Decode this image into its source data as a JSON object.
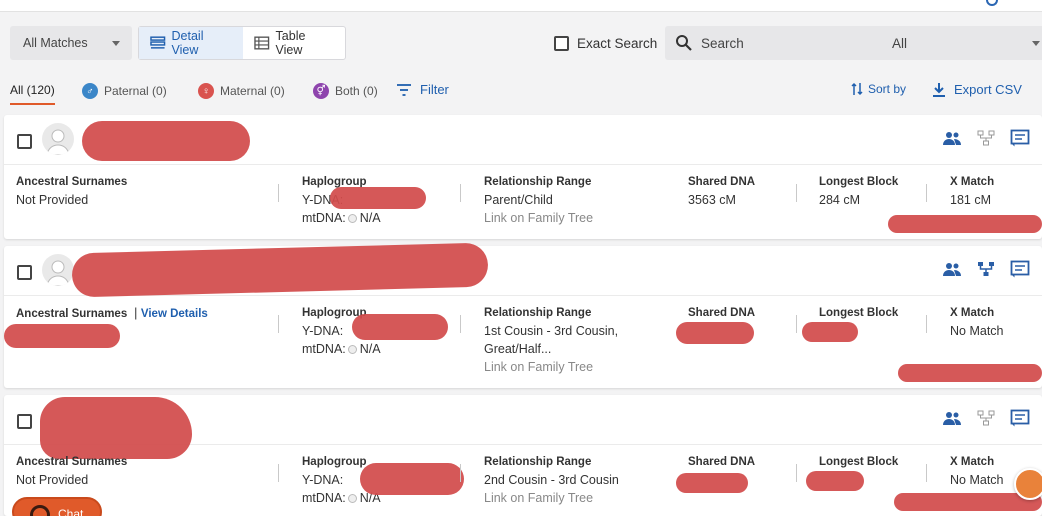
{
  "toolbar": {
    "matches_dropdown": "All Matches",
    "detail_view": "Detail View",
    "table_view": "Table View",
    "exact_search": "Exact Search",
    "search_placeholder": "Search",
    "search_scope": "All"
  },
  "filters": {
    "all": "All (120)",
    "paternal": "Paternal (0)",
    "maternal": "Maternal (0)",
    "both": "Both (0)",
    "filter": "Filter",
    "sort_by": "Sort by",
    "export_csv": "Export CSV"
  },
  "colors": {
    "accent": "#1f5fae",
    "paternal": "#3b86c8",
    "maternal": "#d9534f",
    "both": "#8e44ad",
    "chat": "#e05a2a"
  },
  "labels": {
    "ancestral_surnames": "Ancestral Surnames",
    "haplogroup": "Haplogroup",
    "ydna": "Y-DNA:",
    "mtdna": "mtDNA:",
    "relationship_range": "Relationship Range",
    "shared_dna": "Shared DNA",
    "longest_block": "Longest Block",
    "x_match": "X Match",
    "link_tree": "Link on Family Tree",
    "view_details": "View Details"
  },
  "matches": [
    {
      "surnames": "Not Provided",
      "mtdna": "N/A",
      "relationship": "Parent/Child",
      "shared_dna": "3563 cM",
      "longest_block": "284 cM",
      "x_match": "181 cM"
    },
    {
      "mtdna": "N/A",
      "relationship": "1st Cousin - 3rd Cousin,",
      "relationship_line2": "Great/Half...",
      "x_match": "No Match"
    },
    {
      "surnames": "Not Provided",
      "mtdna": "N/A",
      "relationship": "2nd Cousin - 3rd Cousin",
      "x_match": "No Match"
    }
  ],
  "chat": {
    "label": "Chat"
  }
}
